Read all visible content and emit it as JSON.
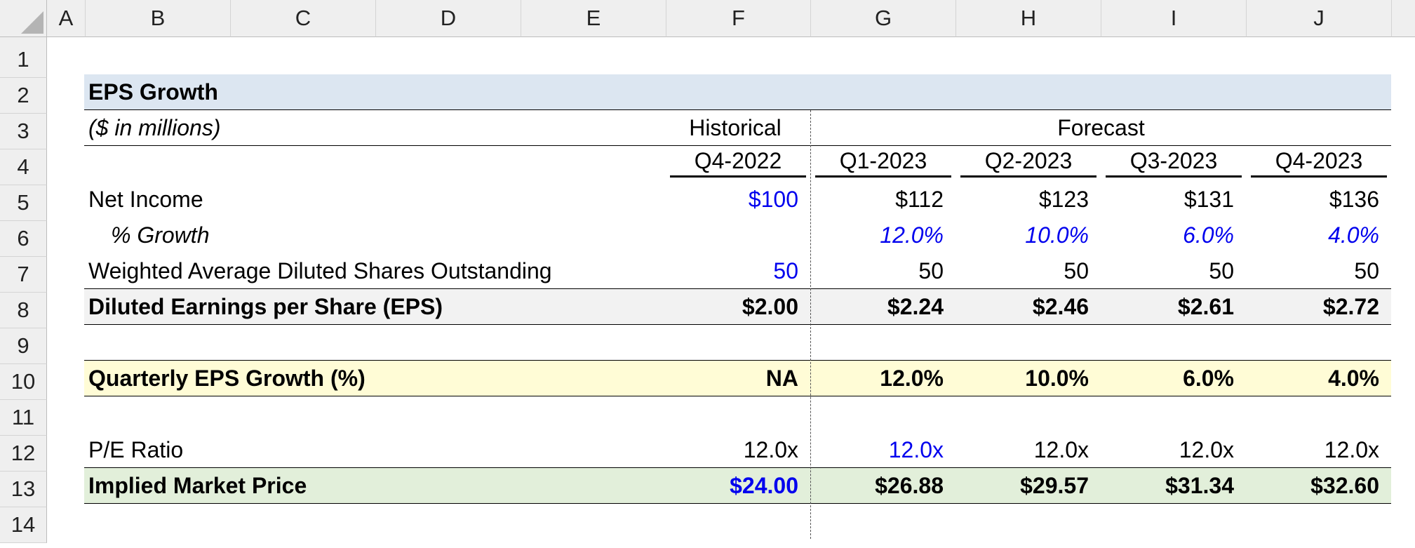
{
  "columns": [
    "A",
    "B",
    "C",
    "D",
    "E",
    "F",
    "G",
    "H",
    "I",
    "J"
  ],
  "rows": [
    "1",
    "2",
    "3",
    "4",
    "5",
    "6",
    "7",
    "8",
    "9",
    "10",
    "11",
    "12",
    "13",
    "14"
  ],
  "colors": {
    "input_blue": "#0000ee",
    "title_fill": "#dce6f1",
    "eps_fill": "#f2f2f2",
    "growth_fill": "#fffcd6",
    "price_fill": "#e2efda"
  },
  "sheet": {
    "title": "EPS Growth",
    "units": "($ in millions)",
    "historical_label": "Historical",
    "forecast_label": "Forecast",
    "periods": [
      "Q4-2022",
      "Q1-2023",
      "Q2-2023",
      "Q3-2023",
      "Q4-2023"
    ],
    "net_income": {
      "label": "Net Income",
      "values": [
        "$100",
        "$112",
        "$123",
        "$131",
        "$136"
      ]
    },
    "growth": {
      "label": "% Growth",
      "values": [
        "",
        "12.0%",
        "10.0%",
        "6.0%",
        "4.0%"
      ]
    },
    "shares": {
      "label": "Weighted Average Diluted Shares Outstanding",
      "values": [
        "50",
        "50",
        "50",
        "50",
        "50"
      ]
    },
    "eps": {
      "label": "Diluted Earnings per Share (EPS)",
      "values": [
        "$2.00",
        "$2.24",
        "$2.46",
        "$2.61",
        "$2.72"
      ]
    },
    "eps_growth": {
      "label": "Quarterly EPS Growth (%)",
      "values": [
        "NA",
        "12.0%",
        "10.0%",
        "6.0%",
        "4.0%"
      ]
    },
    "pe": {
      "label": "P/E Ratio",
      "values": [
        "12.0x",
        "12.0x",
        "12.0x",
        "12.0x",
        "12.0x"
      ]
    },
    "price": {
      "label": "Implied Market Price",
      "values": [
        "$24.00",
        "$26.88",
        "$29.57",
        "$31.34",
        "$32.60"
      ]
    }
  }
}
